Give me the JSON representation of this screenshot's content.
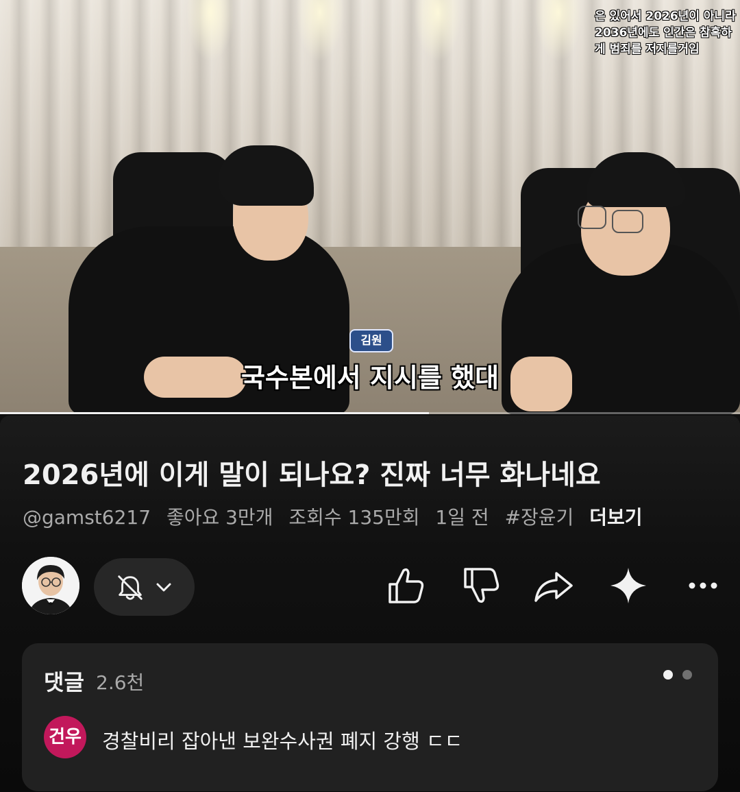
{
  "video": {
    "overlay_lines": [
      "은 있어서 2026년이 아니라",
      "2036년에도 인간은 참혹하",
      "게 범죄를 저지를거임"
    ],
    "speaker_tag": "김원",
    "subtitle": "국수본에서 지시를 했대",
    "progress_fraction": 0.58
  },
  "info": {
    "title": "2026년에 이게 말이 되나요? 진짜 너무 화나네요",
    "channel_handle": "@gamst6217",
    "likes": "좋아요 3만개",
    "views": "조회수 135만회",
    "age": "1일 전",
    "hashtag": "#장윤기",
    "more": "더보기"
  },
  "actions": {
    "icons": [
      "thumbs-up-icon",
      "thumbs-down-icon",
      "share-icon",
      "sparkle-icon",
      "more-icon"
    ]
  },
  "comments": {
    "title": "댓글",
    "count": "2.6천",
    "top_comment": {
      "author_avatar_text": "건우",
      "text": "경찰비리 잡아낸 보완수사권 폐지 강행 ㄷㄷ"
    }
  },
  "colors": {
    "background": "#0f0f0f",
    "comments_bg": "#212121",
    "avatar_pink": "#c2185b",
    "tag_blue": "#2c4f8a"
  }
}
